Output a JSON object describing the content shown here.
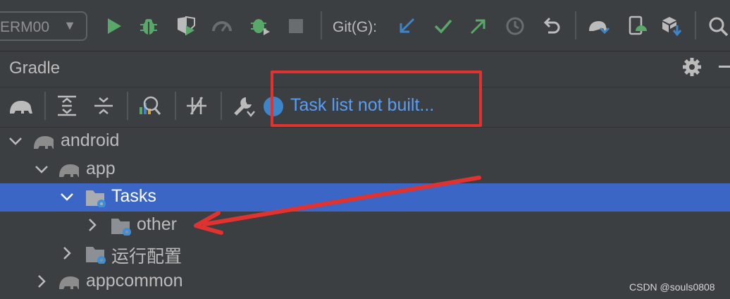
{
  "toolbar": {
    "run_config": "ERM00",
    "git_label": "Git(G):"
  },
  "panel": {
    "title": "Gradle",
    "task_link": "Task list not built..."
  },
  "tree": [
    {
      "label": "android",
      "icon": "gradle-elephant-icon"
    },
    {
      "label": "app",
      "icon": "gradle-elephant-icon"
    },
    {
      "label": "Tasks",
      "icon": "folder-gear-icon",
      "selected": true
    },
    {
      "label": "other",
      "icon": "folder-gear-icon"
    },
    {
      "label": "运行配置",
      "icon": "folder-gear-icon"
    },
    {
      "label": "appcommon",
      "icon": "gradle-elephant-icon"
    }
  ],
  "watermark": "CSDN @souls0808",
  "colors": {
    "accent_blue": "#589df6",
    "selection": "#3b66c5",
    "annotation_red": "#e0322f",
    "run_green": "#59a869"
  }
}
